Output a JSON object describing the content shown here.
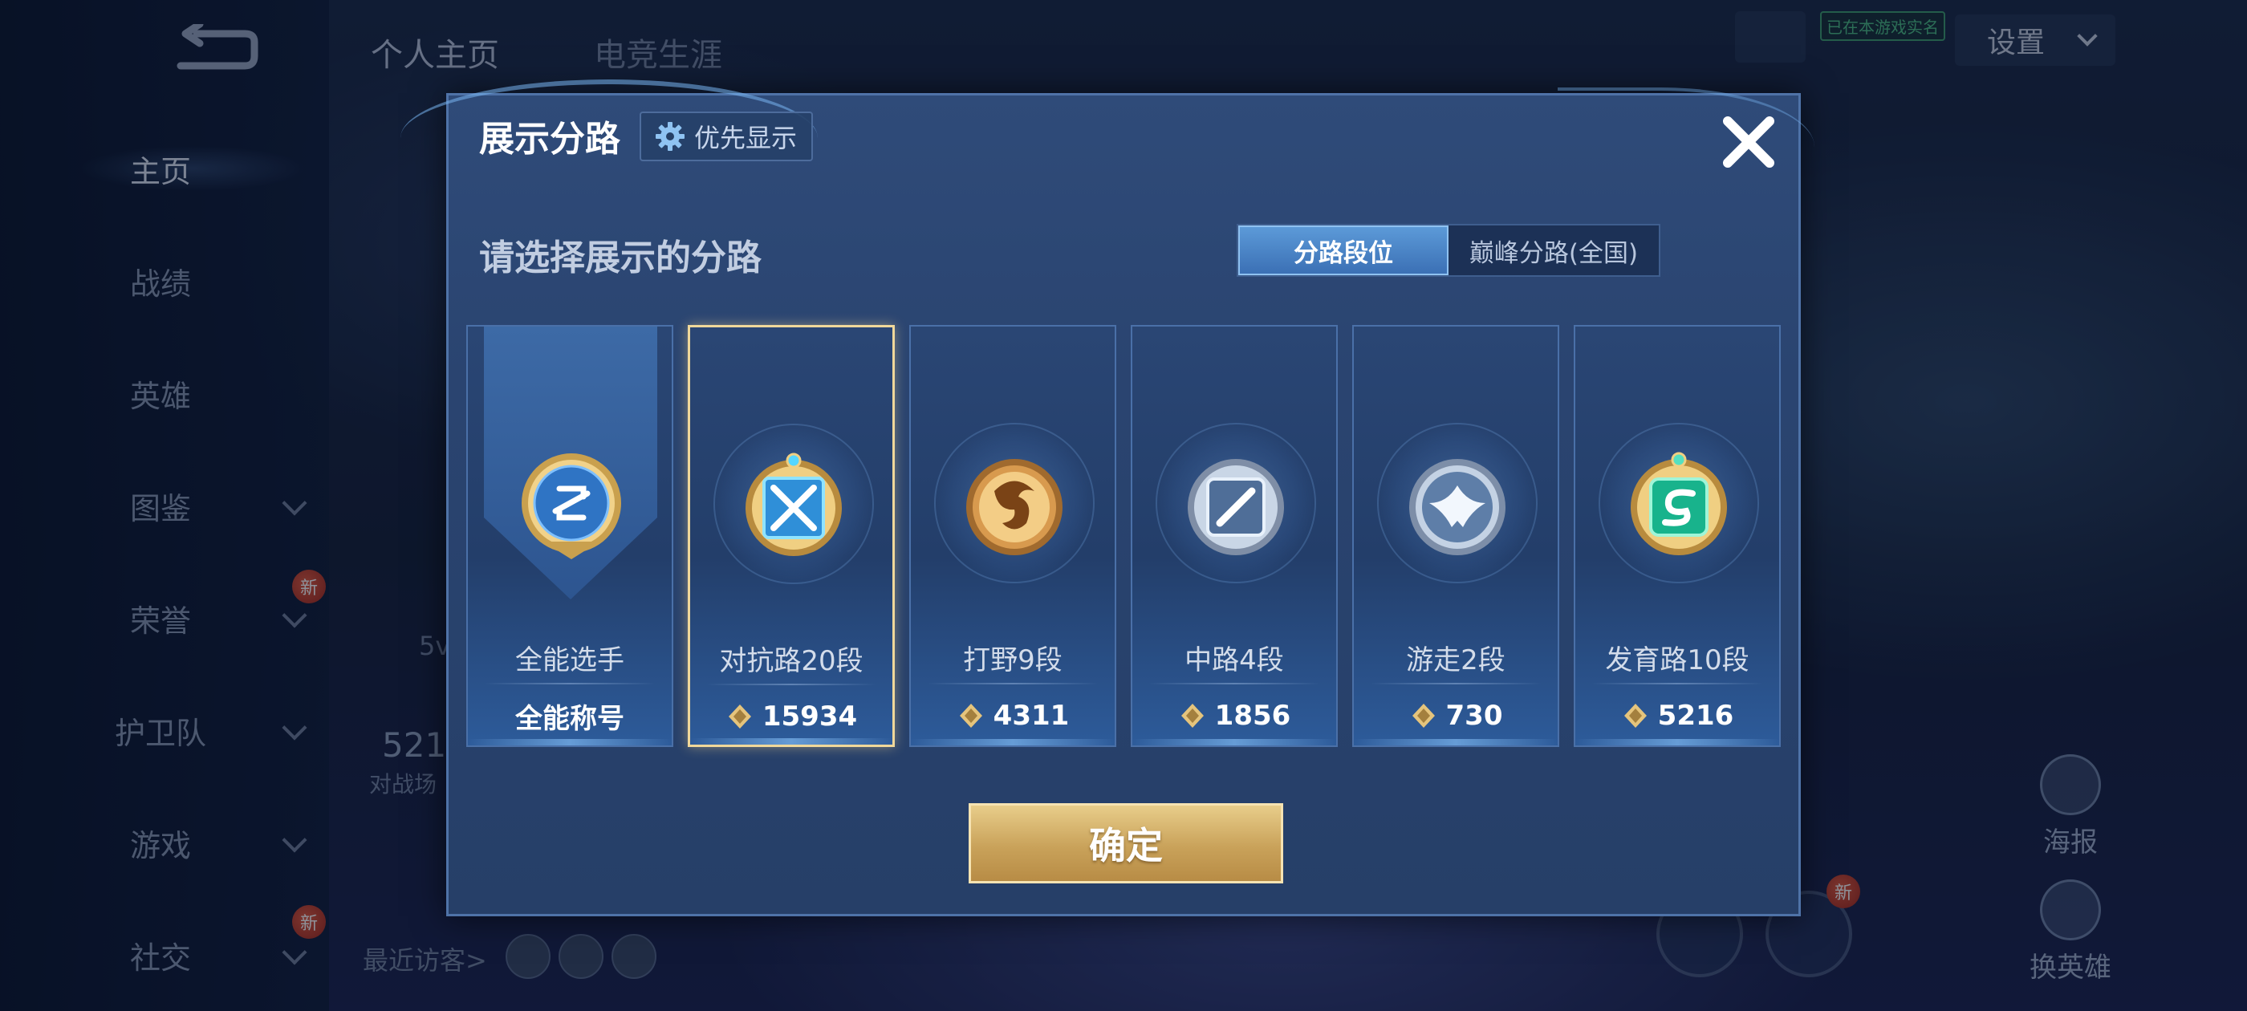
{
  "sidebar": {
    "items": [
      {
        "label": "主页",
        "active": true
      },
      {
        "label": "战绩"
      },
      {
        "label": "英雄"
      },
      {
        "label": "图鉴",
        "chevron": true
      },
      {
        "label": "荣誉",
        "chevron": true,
        "badge": "新"
      },
      {
        "label": "护卫队",
        "chevron": true
      },
      {
        "label": "游戏",
        "chevron": true
      },
      {
        "label": "社交",
        "chevron": true,
        "badge": "新"
      }
    ]
  },
  "header": {
    "tabs": [
      "个人主页",
      "电竞生涯"
    ],
    "settings_label": "设置",
    "realname_tag": "已在本游戏实名"
  },
  "background": {
    "visitors_label": "最近访客>",
    "stats_fragment": "521",
    "stats_caption": "对战场",
    "small_text": "5v",
    "right_buttons": [
      {
        "label": "海报",
        "icon": "poster-icon"
      },
      {
        "label": "换英雄",
        "icon": "swap-hero-icon",
        "badge": "新"
      }
    ]
  },
  "modal": {
    "title": "展示分路",
    "priority_button_label": "优先显示",
    "subtitle": "请选择展示的分路",
    "segment": {
      "options": [
        "分路段位",
        "巅峰分路(全国)"
      ],
      "selected": "分路段位"
    },
    "cards": [
      {
        "label": "全能选手",
        "value": "全能称号",
        "icon": "all-round-badge-icon",
        "type": "banner"
      },
      {
        "label": "对抗路20段",
        "value": "15934",
        "icon": "clash-lane-badge-icon",
        "selected": true
      },
      {
        "label": "打野9段",
        "value": "4311",
        "icon": "jungle-badge-icon"
      },
      {
        "label": "中路4段",
        "value": "1856",
        "icon": "mid-lane-badge-icon"
      },
      {
        "label": "游走2段",
        "value": "730",
        "icon": "roam-badge-icon"
      },
      {
        "label": "发育路10段",
        "value": "5216",
        "icon": "farm-lane-badge-icon"
      }
    ],
    "confirm_label": "确定"
  },
  "colors": {
    "accent_gold": "#c9a25a",
    "modal_bg": "#2a4470",
    "selected_border": "#f0d89a",
    "segment_active": "#4a86c8"
  }
}
